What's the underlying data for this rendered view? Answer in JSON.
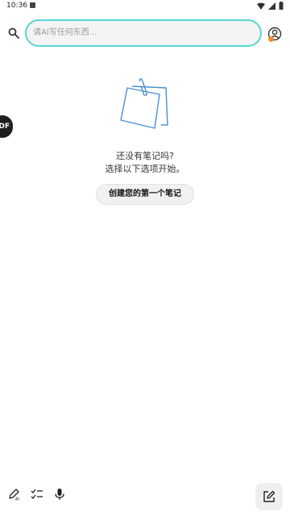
{
  "status_bar": {
    "time": "10:36"
  },
  "search": {
    "placeholder": "请AI写任何东西..."
  },
  "side_chip": {
    "label": "DF"
  },
  "empty_state": {
    "line1": "还没有笔记吗?",
    "line2": "选择以下选项开始。",
    "button_label": "创建您的第一个笔记"
  },
  "icons": {
    "search": "search-icon",
    "account": "account-icon",
    "illustration": "sticky-note-clip-icon",
    "ai_pen": "ai-pen-icon",
    "checklist": "checklist-icon",
    "mic": "microphone-icon",
    "compose": "compose-icon"
  },
  "colors": {
    "accent": "#56d6d2",
    "badge": "#f28c28",
    "illustration": "#4a8fd4"
  }
}
